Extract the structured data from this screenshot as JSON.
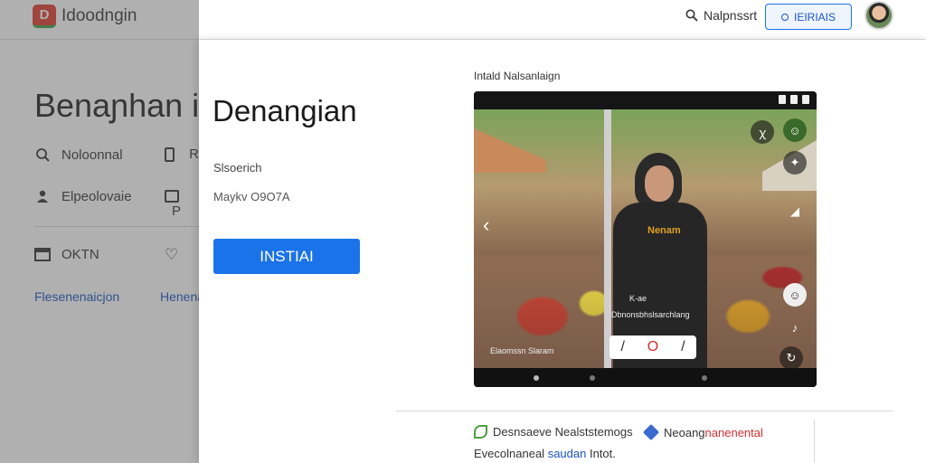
{
  "header": {
    "logo_mark": "D",
    "logo_text": "Idoodngin",
    "search_label": "Nalpnssrt",
    "button_label": "IEIRIAIS"
  },
  "background_page": {
    "title": "Benaɲhan in",
    "rows": [
      {
        "icon": "search-icon",
        "label": "Noloonnal",
        "right_icon": "phone-icon",
        "right_label": "R"
      },
      {
        "icon": "person-icon",
        "label": "Elpeolovaie",
        "right_icon": "image-icon",
        "right_label": "P"
      },
      {
        "icon": "calendar-icon",
        "label": "OKTN",
        "right_icon": "heart-icon",
        "right_label": ""
      }
    ],
    "links": [
      "Flesenenaicjon",
      "Henenar"
    ]
  },
  "app": {
    "title": "Denangian",
    "subtitle": "Slsoerich",
    "meta": "Maykv O9O7A",
    "install_label": "INSTIAI"
  },
  "screenshot": {
    "label": "Intald Nalsanlaign",
    "shirt_print": "Nenam",
    "caption_small": "K-ae",
    "caption_line": "Dbnonsbhslsarchlang",
    "bottom_caption": "Elaomssn Slaram"
  },
  "features": {
    "item1": "Desnsaeve Nealststemogs",
    "item2_prefix": "Neoang",
    "item2_suffix": "nanenental",
    "line2_prefix": "Evecolnaneal",
    "line2_link": "saudan",
    "line2_suffix": "Intot."
  },
  "colors": {
    "accent": "#1a73e8",
    "logo_red": "#e23c2e",
    "link": "#1a55c0"
  }
}
